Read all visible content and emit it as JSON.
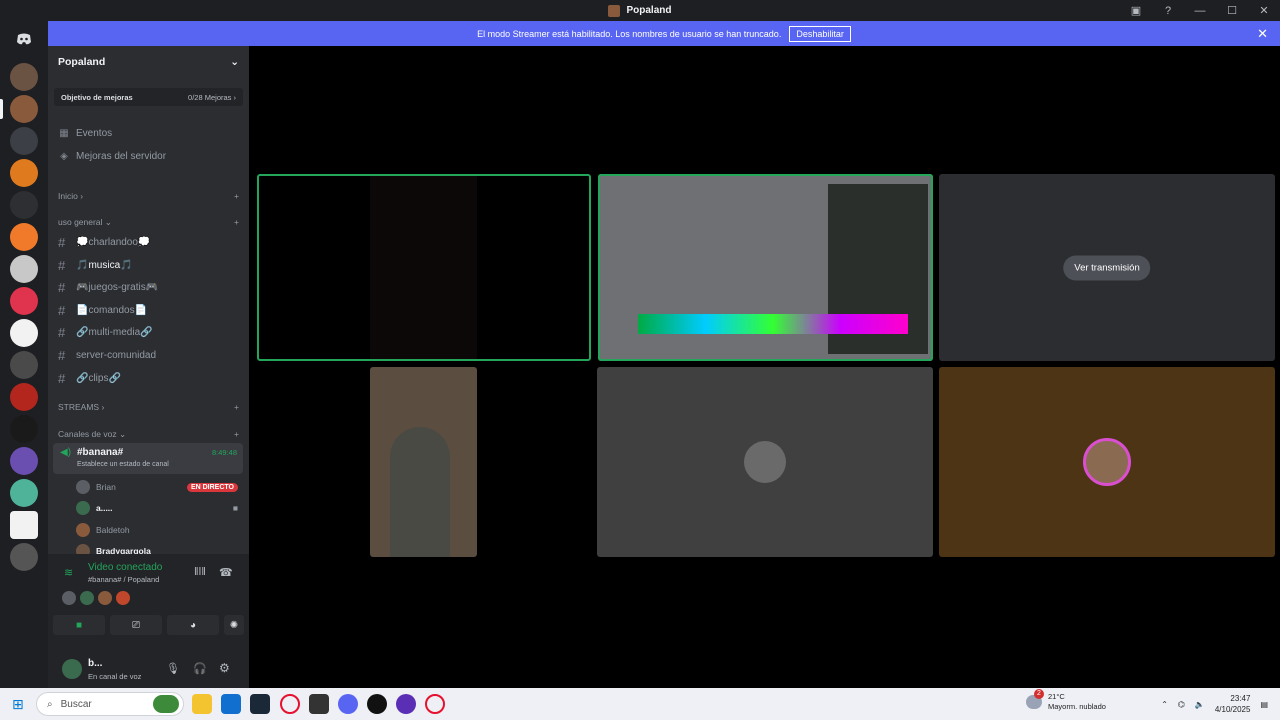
{
  "window": {
    "title": "Popaland"
  },
  "banner": {
    "text": "El modo Streamer está habilitado. Los nombres de usuario se han truncado.",
    "button": "Deshabilitar"
  },
  "server": {
    "name": "Popaland"
  },
  "boost": {
    "label": "Objetivo de mejoras",
    "count": "0/28 Mejoras"
  },
  "side_items": [
    {
      "label": "Eventos",
      "icon": "calendar-icon"
    },
    {
      "label": "Mejoras del servidor",
      "icon": "boost-icon"
    }
  ],
  "categories": {
    "inicio": "Inicio",
    "general": "uso general",
    "streams": "STREAMS",
    "voz": "Canales de voz"
  },
  "channels": [
    "💭charlandoo💭",
    "🎵musica🎵",
    "🎮juegos-gratis🎮",
    "📄comandos📄",
    "🔗multi-media🔗",
    "server-comunidad",
    "🔗clips🔗"
  ],
  "voice_channel": {
    "name": "#banana#",
    "status": "Establece un estado de canal",
    "timer": "8:49:48"
  },
  "voice_users": [
    {
      "name": "Brian",
      "badge": "EN DIRECTO"
    },
    {
      "name": "a....."
    },
    {
      "name": "Baldetoh"
    },
    {
      "name": "Bradygargola"
    }
  ],
  "voice_panel": {
    "status": "Video conectado",
    "location": "#banana# / Popaland"
  },
  "user": {
    "name": "b...",
    "status": "En canal de voz"
  },
  "stage": {
    "watch_stream": "Ver transmisión"
  },
  "taskbar": {
    "search_placeholder": "Buscar",
    "weather_temp": "21°C",
    "weather_desc": "Mayorm. nublado",
    "weather_badge": "2",
    "time": "23:47",
    "date": "4/10/2025"
  },
  "colors": {
    "accent": "#5865f2",
    "online": "#23a55a",
    "live": "#da373c",
    "tile_orange": "#4c3414",
    "tile_gray": "#404040"
  }
}
